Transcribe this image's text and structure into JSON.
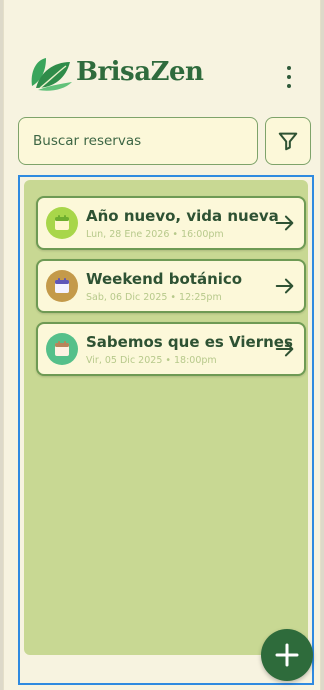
{
  "app": {
    "brand": "BrisaZen"
  },
  "search": {
    "placeholder": "Buscar reservas"
  },
  "reservations": [
    {
      "title": "Año nuevo, vida nueva",
      "subtitle": "Lun, 28 Ene 2026 • 16:00pm",
      "icon": "calendar-icon",
      "icon_bg": "#a8d64a",
      "icon_fg": "#6fae2f"
    },
    {
      "title": "Weekend botánico",
      "subtitle": "Sab, 06 Dic 2025 • 12:25pm",
      "icon": "calendar-icon",
      "icon_bg": "#c49a4a",
      "icon_fg": "#5f56b8"
    },
    {
      "title": "Sabemos que es Viernes",
      "subtitle": "Vir, 05 Dic 2025 • 18:00pm",
      "icon": "calendar-icon",
      "icon_bg": "#55c08a",
      "icon_fg": "#b8855a"
    }
  ],
  "colors": {
    "brand_green": "#2f6b3d",
    "list_background": "#c8d893",
    "card_border": "#6e9a54",
    "fab_background": "#2e6b3b",
    "selection_outline": "#2f8ae0"
  }
}
